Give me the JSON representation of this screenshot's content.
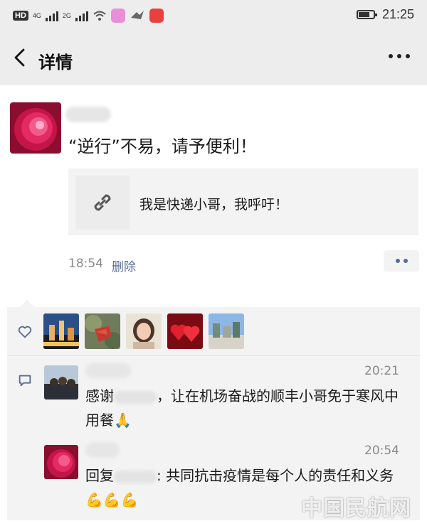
{
  "status_bar": {
    "hd_label": "HD",
    "network_1": "4G",
    "network_2": "2G",
    "time": "21:25"
  },
  "nav": {
    "title": "详情"
  },
  "post": {
    "text": "“逆行”不易，请予便利！",
    "link_title": "我是快递小哥，我呼吁！",
    "time": "18:54",
    "delete_label": "删除"
  },
  "comments": [
    {
      "time": "20:21",
      "text_before": "感谢",
      "text_after": "，让在机场奋战的顺丰小哥免于寒风中用餐",
      "emoji": "🙏"
    },
    {
      "time": "20:54",
      "text_before": "回复",
      "text_after": ": 共同抗击疫情是每个人的责任和义务",
      "emoji": "💪💪💪"
    }
  ],
  "watermark": "中国民航网",
  "colors": {
    "bar_bg": "#ededed",
    "link_blue": "#576b95",
    "panel_bg": "#f3f3f3",
    "muted": "#8a8a8a"
  }
}
